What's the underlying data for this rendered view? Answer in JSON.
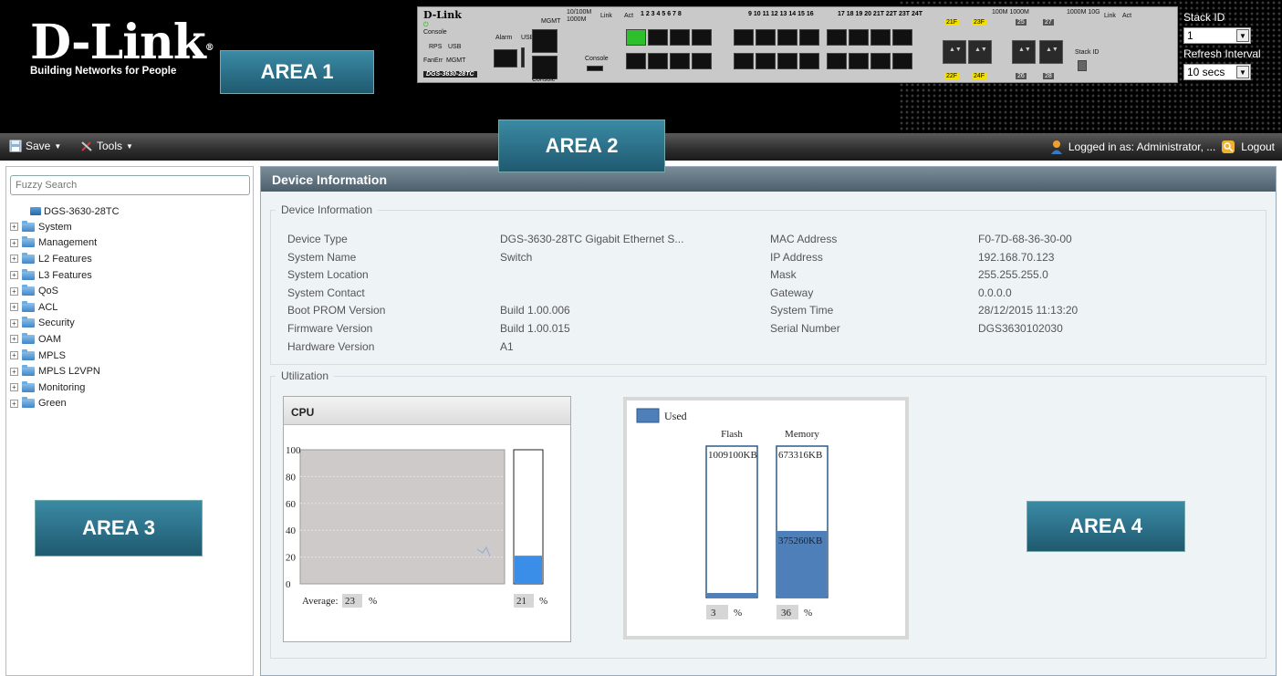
{
  "header": {
    "brand": "D-Link",
    "tagline": "Building Networks for People",
    "device_brand": "D-Link",
    "device_model": "DGS-3630-28TC",
    "panel_labels": {
      "console": "Console",
      "rps": "RPS",
      "usb": "USB",
      "fan": "Fan",
      "err": "Err",
      "mgmt": "MGMT",
      "alarm": "Alarm",
      "usb2": "USB",
      "console2": "Console",
      "console3": "Console",
      "mgmt_top": "MGMT",
      "speed1": "10/100M",
      "speed2": "1000M",
      "link": "Link",
      "act": "Act",
      "stack_id": "Stack ID",
      "ports_a": "1 2 3 4 5 6 7 8",
      "ports_b": "9 10 11 12 13 14 15 16",
      "ports_c": "17 18 19 20 21T 22T 23T 24T",
      "p21f": "21F",
      "p22f": "22F",
      "p23f": "23F",
      "p24f": "24F",
      "p25": "25",
      "p26": "26",
      "p27": "27",
      "p28": "28",
      "speed3": "100M 1000M",
      "speed4": "1000M 10G",
      "link2": "Link",
      "act2": "Act"
    },
    "stack": {
      "stack_id_label": "Stack ID",
      "stack_id_value": "1",
      "refresh_label": "Refresh Interval",
      "refresh_value": "10 secs"
    }
  },
  "area_labels": {
    "area1": "AREA 1",
    "area2": "AREA 2",
    "area3": "AREA 3",
    "area4": "AREA 4"
  },
  "toolbar": {
    "save_label": "Save",
    "tools_label": "Tools",
    "logged_in": "Logged in as: Administrator, ...",
    "logout_label": "Logout"
  },
  "sidebar": {
    "search_placeholder": "Fuzzy Search",
    "root": "DGS-3630-28TC",
    "items": [
      {
        "label": "System"
      },
      {
        "label": "Management"
      },
      {
        "label": "L2 Features"
      },
      {
        "label": "L3 Features"
      },
      {
        "label": "QoS"
      },
      {
        "label": "ACL"
      },
      {
        "label": "Security"
      },
      {
        "label": "OAM"
      },
      {
        "label": "MPLS"
      },
      {
        "label": "MPLS L2VPN"
      },
      {
        "label": "Monitoring"
      },
      {
        "label": "Green"
      }
    ]
  },
  "main": {
    "title": "Device Information",
    "info_legend": "Device Information",
    "left_info": [
      {
        "label": "Device Type",
        "value": "DGS-3630-28TC Gigabit Ethernet S..."
      },
      {
        "label": "System Name",
        "value": "Switch"
      },
      {
        "label": "System Location",
        "value": ""
      },
      {
        "label": "System Contact",
        "value": ""
      },
      {
        "label": "Boot PROM Version",
        "value": "Build 1.00.006"
      },
      {
        "label": "Firmware Version",
        "value": "Build 1.00.015"
      },
      {
        "label": "Hardware Version",
        "value": "A1"
      }
    ],
    "right_info": [
      {
        "label": "MAC Address",
        "value": "F0-7D-68-36-30-00"
      },
      {
        "label": "IP Address",
        "value": "192.168.70.123"
      },
      {
        "label": "Mask",
        "value": "255.255.255.0"
      },
      {
        "label": "Gateway",
        "value": "0.0.0.0"
      },
      {
        "label": "System Time",
        "value": "28/12/2015 11:13:20"
      },
      {
        "label": "Serial Number",
        "value": "DGS3630102030"
      }
    ],
    "util_legend": "Utilization",
    "cpu": {
      "title": "CPU",
      "y_ticks": [
        "100",
        "80",
        "60",
        "40",
        "20",
        "0"
      ],
      "average_label": "Average:",
      "average_value": "23",
      "current_value": "21",
      "percent_sign": "%",
      "average_pct": 23,
      "current_pct": 21
    },
    "memory": {
      "legend_label": "Used",
      "flash_label": "Flash",
      "memory_label": "Memory",
      "flash_total": "1009100KB",
      "memory_total": "673316KB",
      "memory_used": "375260KB",
      "flash_pct_text": "3",
      "memory_pct_text": "36",
      "percent_sign": "%",
      "flash_used_pct": 3,
      "memory_used_pct": 44,
      "used_color": "#4f7fb8"
    }
  }
}
